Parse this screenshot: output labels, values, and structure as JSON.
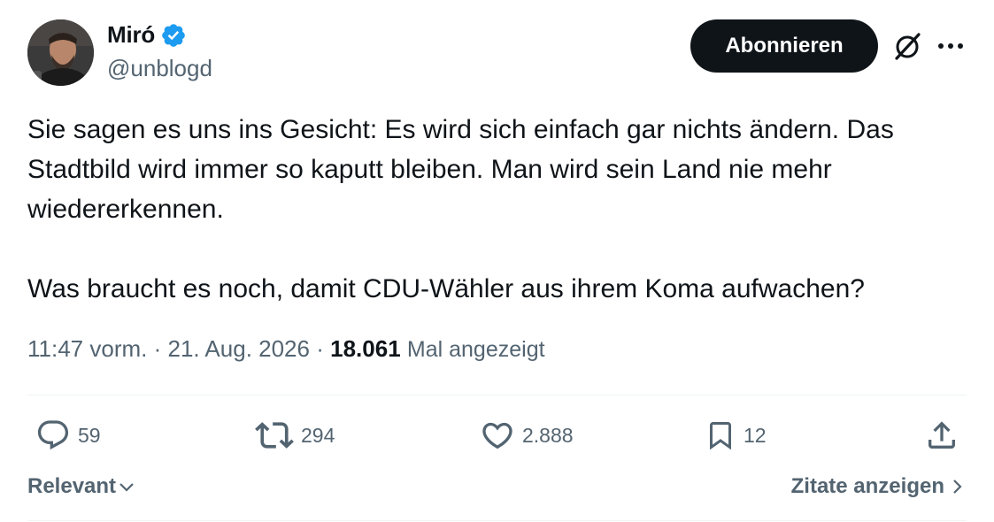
{
  "author": {
    "display_name": "Miró",
    "handle": "@unblogd",
    "verified_color": "#1d9bf0"
  },
  "header": {
    "subscribe_label": "Abonnieren",
    "grok_icon": "grok-icon",
    "more_icon": "more-icon"
  },
  "tweet": {
    "text": "Sie sagen es uns ins Gesicht: Es wird sich einfach gar nichts ändern. Das Stadtbild wird immer so kaputt bleiben. Man wird sein Land nie mehr wiedererkennen.\n\nWas braucht es noch, damit CDU-Wähler aus ihrem Koma aufwachen?",
    "time": "11:47 vorm.",
    "separator": "·",
    "date": "21. Aug. 2026",
    "views_count": "18.061",
    "views_label": "Mal angezeigt"
  },
  "actions": {
    "replies": "59",
    "reposts": "294",
    "likes": "2.888",
    "bookmarks": "12",
    "icons": [
      "reply-icon",
      "repost-icon",
      "like-icon",
      "bookmark-icon",
      "share-icon"
    ]
  },
  "footer": {
    "sort_label": "Relevant",
    "quotes_label": "Zitate anzeigen"
  },
  "colors": {
    "text_primary": "#0f1419",
    "text_secondary": "#536471",
    "button_bg": "#0f1419",
    "divider": "#eff3f4"
  }
}
